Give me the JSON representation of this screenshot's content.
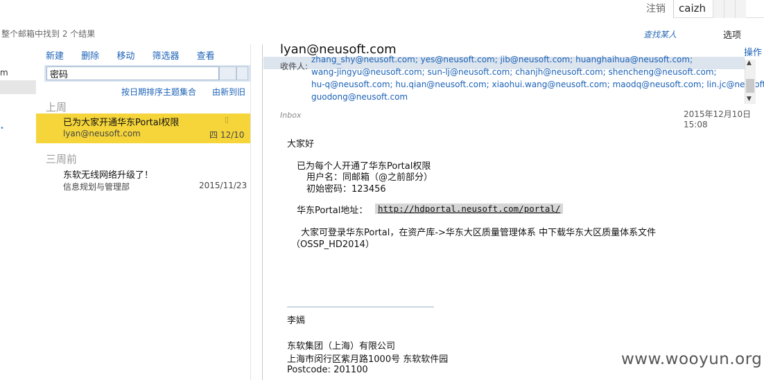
{
  "header": {
    "logout": "注销",
    "username": "caizh",
    "search_result": "整个邮箱中找到 2 个结果",
    "find_people": "查找某人",
    "options": "选项"
  },
  "nav": {
    "partial_label": "m",
    "dot": "•"
  },
  "toolbar": {
    "new": "新建",
    "delete": "删除",
    "move": "移动",
    "filter": "筛选器",
    "view": "查看"
  },
  "search": {
    "value": "密码"
  },
  "sort": {
    "label": "按日期排序主题集合",
    "direction": "由新到旧"
  },
  "groups": [
    {
      "label": "上周"
    },
    {
      "label": "三周前"
    }
  ],
  "messages": [
    {
      "subject": "已为大家开通华东Portal权限",
      "from": "lyan@neusoft.com",
      "date": "四 12/10",
      "flag": "▯"
    },
    {
      "subject": "东软无线网络升级了！",
      "from": "信息规划与管理部",
      "date": "2015/11/23"
    }
  ],
  "reading": {
    "sender": "lyan@neusoft.com",
    "action": "操作",
    "to_label": "收件人:",
    "recipients_lines": [
      "zhang_shy@neusoft.com; yes@neusoft.com; jib@neusoft.com; huanghaihua@neusoft.com;",
      "wang-jingyu@neusoft.com; sun-lj@neusoft.com; chanjh@neusoft.com; shencheng@neusoft.com;",
      "hu-q@neusoft.com; hu.qian@neusoft.com; xiaohui.wang@neusoft.com; maodq@neusoft.com; lin.jc@neusoft.com;",
      "guodong@neusoft.com"
    ],
    "folder": "Inbox",
    "date": "2015年12月10日 15:08",
    "body": {
      "greeting": "大家好",
      "line1": "已为每个人开通了华东Portal权限",
      "line2": "用户名：同邮箱（@之前部分）",
      "line3": "初始密码：123456",
      "portal_label": "华东Portal地址：",
      "portal_url": "http://hdportal.neusoft.com/portal/",
      "line4": "大家可登录华东Portal，在资产库->华东大区质量管理体系 中下载华东大区质量体系文件",
      "line5": "（OSSP_HD2014）",
      "sig_name": "李嫣",
      "sig_company": "东软集团（上海）有限公司",
      "sig_address": "上海市闵行区紫月路1000号 东软软件园",
      "sig_postcode": "Postcode: 201100"
    }
  },
  "watermark": "www.wooyun.org"
}
